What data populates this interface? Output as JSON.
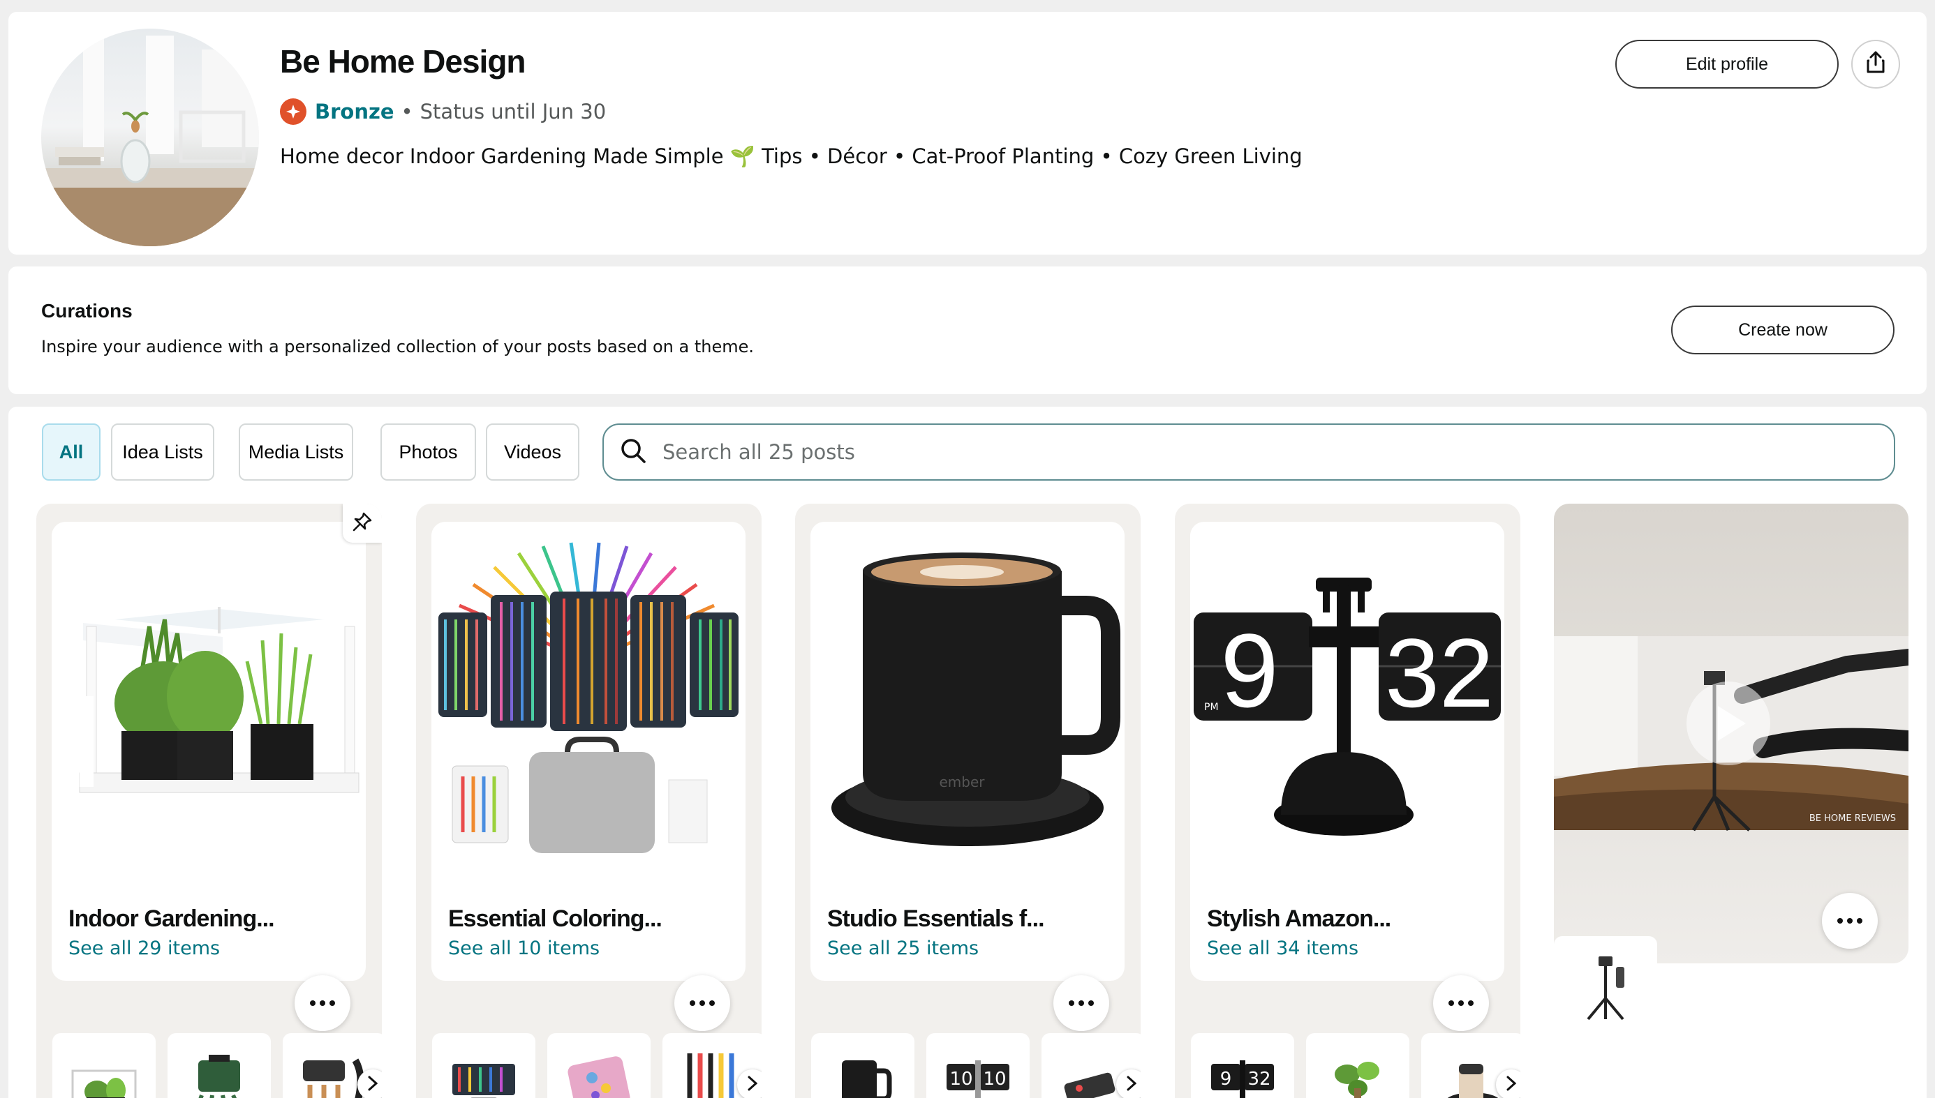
{
  "profile": {
    "name": "Be Home Design",
    "tier": "Bronze",
    "status": "Status until Jun 30",
    "bio": "Home decor Indoor Gardening Made Simple 🌱 Tips • Décor • Cat-Proof Planting • Cozy Green Living",
    "edit_label": "Edit profile",
    "share_icon": "share-icon",
    "badge_color": "#e0512a"
  },
  "curations": {
    "title": "Curations",
    "description": "Inspire your audience with a personalized collection of your posts based on a theme.",
    "cta": "Create now"
  },
  "filters": [
    "All",
    "Idea Lists",
    "Media Lists",
    "Photos",
    "Videos"
  ],
  "search": {
    "placeholder": "Search all 25 posts"
  },
  "collections": [
    {
      "title": "Indoor Gardening...",
      "link": "See all 29 items"
    },
    {
      "title": "Essential Coloring...",
      "link": "See all 10 items"
    },
    {
      "title": "Studio Essentials f...",
      "link": "See all 25 items"
    },
    {
      "title": "Stylish Amazon...",
      "link": "See all 34 items"
    }
  ],
  "clock": {
    "hour": "9",
    "minute": "32",
    "ampm": "PM",
    "thumb_hour": "10",
    "thumb_minute": "10"
  },
  "mug_brand": "ember",
  "video": {
    "watermark": "BE HOME REVIEWS"
  },
  "colors": {
    "accent": "#047481",
    "active_chip_bg": "#e6f6fb",
    "card_bg": "#f2f0ed"
  }
}
